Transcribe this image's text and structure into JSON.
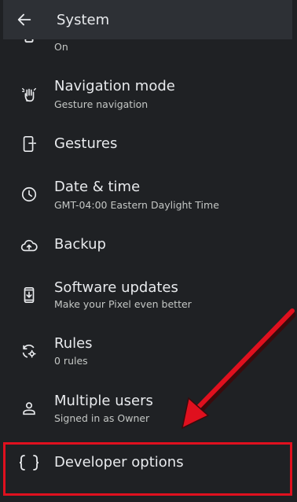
{
  "app_bar": {
    "title": "System",
    "back_icon": "arrow-back-icon"
  },
  "items": [
    {
      "id": "partial-top",
      "icon": "phone-icon",
      "title": "",
      "subtitle": "On"
    },
    {
      "id": "navigation-mode",
      "icon": "gesture-hand-icon",
      "title": "Navigation mode",
      "subtitle": "Gesture navigation"
    },
    {
      "id": "gestures",
      "icon": "phone-gesture-icon",
      "title": "Gestures",
      "subtitle": ""
    },
    {
      "id": "date-time",
      "icon": "clock-icon",
      "title": "Date & time",
      "subtitle": "GMT-04:00 Eastern Daylight Time"
    },
    {
      "id": "backup",
      "icon": "cloud-upload-icon",
      "title": "Backup",
      "subtitle": ""
    },
    {
      "id": "software-updates",
      "icon": "system-update-icon",
      "title": "Software updates",
      "subtitle": "Make your Pixel even better"
    },
    {
      "id": "rules",
      "icon": "rules-icon",
      "title": "Rules",
      "subtitle": "0 rules"
    },
    {
      "id": "multiple-users",
      "icon": "person-icon",
      "title": "Multiple users",
      "subtitle": "Signed in as Owner"
    },
    {
      "id": "developer-options",
      "icon": "braces-icon",
      "title": "Developer options",
      "subtitle": ""
    }
  ],
  "annotation": {
    "highlight_color": "#e0101e"
  }
}
